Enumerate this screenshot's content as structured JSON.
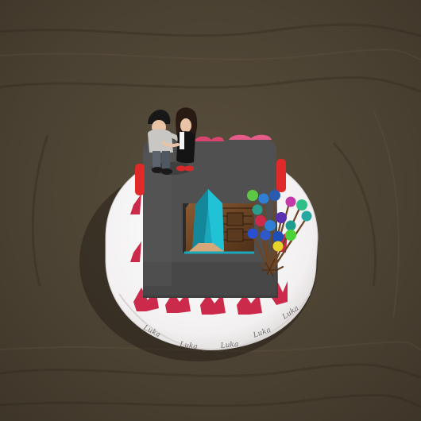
{
  "scene": {
    "subject": "cake",
    "colors": {
      "floor_dark": "#3d3528",
      "floor_mid": "#4a4132",
      "floor_light": "#5a4f3d",
      "board_white": "#f2f0f0",
      "board_shadow": "#cfcccc",
      "cake_top": "#4f4f4f",
      "cake_side": "#3e3e3e",
      "frosting_red": "#cc2a4a",
      "roof_teal": "#1aa9bc",
      "wood_brown": "#6b4526",
      "skin": "#e9c3a6"
    },
    "icons": [
      "standing-couple-figure",
      "balloon-bouquet",
      "house-ornament",
      "red-candle",
      "pink-bow"
    ],
    "board_text": [
      "Luka",
      "Luka",
      "Luka",
      "Luka",
      "Luka"
    ]
  }
}
